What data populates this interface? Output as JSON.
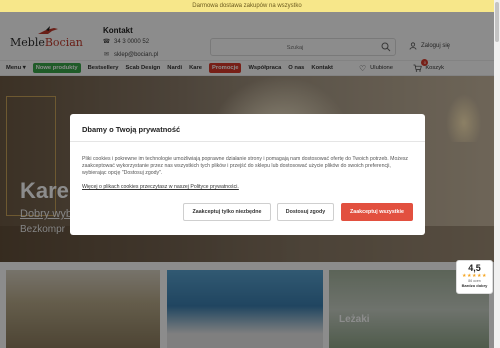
{
  "promo_bar": {
    "text": "Darmowa dostawa zakupów na wszystko"
  },
  "header": {
    "logo": {
      "text_main": "Meble",
      "text_accent": "Bocian"
    },
    "contact": {
      "title": "Kontakt",
      "phone": "34 3 0000 52",
      "email": "sklep@bocian.pl"
    },
    "search": {
      "placeholder": "Szukaj"
    },
    "login_label": "Zaloguj się"
  },
  "nav": {
    "menu_label": "Menu",
    "items": [
      "Nowe produkty",
      "Bestsellery",
      "Scab Design",
      "Nardi",
      "Kare",
      "Promocje",
      "Współpraca",
      "O nas",
      "Kontakt"
    ],
    "wishlist_label": "Ulubione",
    "cart_label": "Koszyk",
    "cart_count": "0"
  },
  "hero": {
    "title": "Kare",
    "subtitle": "Dobry wyb",
    "subtitle2": "Bezkompr"
  },
  "tiles": [
    {
      "label": ""
    },
    {
      "label": ""
    },
    {
      "label": "Leżaki"
    }
  ],
  "rating": {
    "score": "4,5",
    "stars": "★★★★★",
    "count": "86 ocen",
    "label": "Bardzo dobry"
  },
  "cookie_modal": {
    "title": "Dbamy o Twoją prywatność",
    "body": "Pliki cookies i pokrewne im technologie umożliwiają poprawne działanie strony i pomagają nam dostosować ofertę do Twoich potrzeb. Możesz zaakceptować wykorzystanie przez nas wszystkich tych plików i przejść do sklepu lub dostosować użycie plików do swoich preferencji, wybierając opcję \"Dostosuj zgody\".",
    "link": "Więcej o plikach cookies przeczytasz w naszej Polityce prywatności.",
    "buttons": {
      "necessary": "Zaakceptuj tylko niezbędne",
      "customize": "Dostosuj zgody",
      "accept_all": "Zaakceptuj wszystkie"
    }
  },
  "colors": {
    "accent": "#e2503f",
    "green_badge": "#3aa64a",
    "promo_bg": "#f7e78a"
  }
}
